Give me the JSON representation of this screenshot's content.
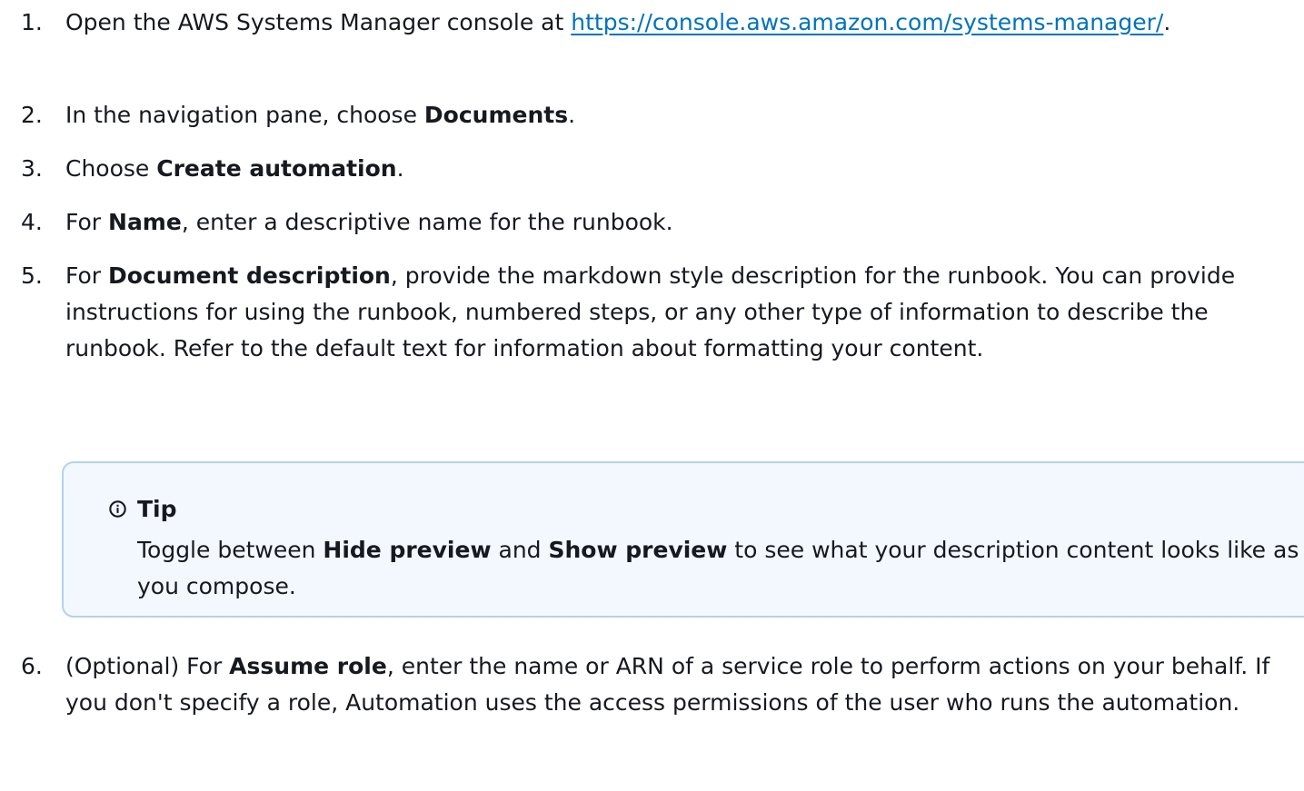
{
  "steps": [
    {
      "number": "1.",
      "text_before": "Open the AWS Systems Manager console at ",
      "link": "https://console.aws.amazon.com/systems-manager/",
      "text_after": "."
    },
    {
      "number": "2.",
      "text_before": "In the navigation pane, choose ",
      "bold": "Documents",
      "text_after": "."
    },
    {
      "number": "3.",
      "text_before": "Choose ",
      "bold": "Create automation",
      "text_after": "."
    },
    {
      "number": "4.",
      "text_before": "For ",
      "bold": "Name",
      "text_after": ", enter a descriptive name for the runbook."
    },
    {
      "number": "5.",
      "text_before": "For ",
      "bold": "Document description",
      "text_after": ", provide the markdown style description for the runbook. You can provide instructions for using the runbook, numbered steps, or any other type of information to describe the runbook. Refer to the default text for information about formatting your content."
    },
    {
      "number": "6.",
      "text_before": "(Optional) For ",
      "bold": "Assume role",
      "text_after": ", enter the name or ARN of a service role to perform actions on your behalf. If you don't specify a role, Automation uses the access permissions of the user who runs the automation."
    }
  ],
  "tip": {
    "icon": "info-icon",
    "title": "Tip",
    "text_before": "Toggle between ",
    "bold_1": "Hide preview",
    "text_middle": " and ",
    "bold_2": "Show preview",
    "text_after": " to see what your description content looks like as you compose."
  },
  "colors": {
    "link": "#0073bb",
    "tip_background": "#f2f8fd",
    "tip_border": "#b5d2ea",
    "text": "#16191f"
  }
}
